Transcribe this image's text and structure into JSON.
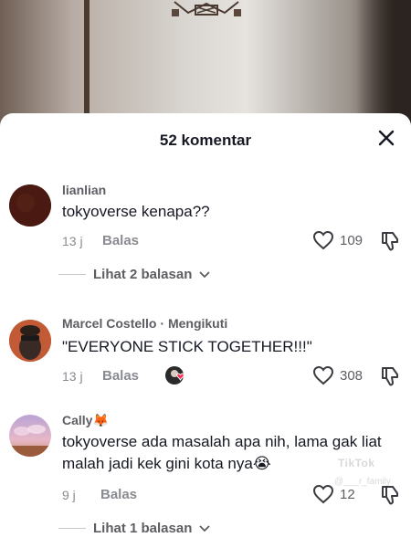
{
  "sheet": {
    "title": "52 komentar",
    "close_icon": "close-icon"
  },
  "comments": [
    {
      "author": "lianlian",
      "text": "tokyoverse kenapa??",
      "time": "13 j",
      "reply_label": "Balas",
      "likes": "109",
      "view_replies": "Lihat 2 balasan",
      "avatar_color": "#4a1a12"
    },
    {
      "author": "Marcel Costello",
      "follow_text": "Mengikuti",
      "text": "\"EVERYONE STICK TOGETHER!!!\"",
      "time": "13 j",
      "reply_label": "Balas",
      "likes": "308",
      "creator_liked_icon": "creator-liked-badge-icon",
      "avatar_color": "#b0442a"
    },
    {
      "author": "Cally",
      "author_emoji": "🦊",
      "text": "tokyoverse ada masalah apa nih, lama gak liat malah jadi kek gini kota nya😭",
      "time": "9 j",
      "reply_label": "Balas",
      "likes": "12",
      "view_replies": "Lihat 1 balasan",
      "avatar_color": "#c9a4c8"
    }
  ],
  "watermark": {
    "brand": "TikTok",
    "handle": "@___r_family"
  },
  "colors": {
    "text_primary": "#161823",
    "text_secondary": "#8a8b91",
    "background": "#ffffff"
  }
}
